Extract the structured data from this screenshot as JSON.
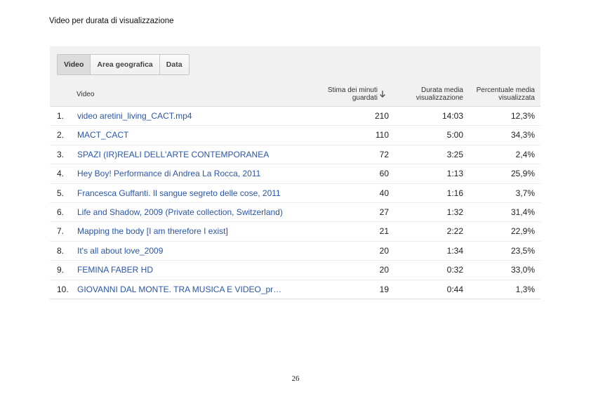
{
  "doc": {
    "title": "Video per durata di visualizzazione",
    "page_number": "26"
  },
  "tabs": [
    {
      "label": "Video",
      "active": true
    },
    {
      "label": "Area geografica",
      "active": false
    },
    {
      "label": "Data",
      "active": false
    }
  ],
  "columns": {
    "video": "Video",
    "minutes_line1": "Stima dei minuti",
    "minutes_line2": "guardati",
    "duration_line1": "Durata media",
    "duration_line2": "visualizzazione",
    "percent_line1": "Percentuale media",
    "percent_line2": "visualizzata",
    "sort_icon": "arrow-down-icon"
  },
  "rows": [
    {
      "num": "1.",
      "title": "video aretini_living_CACT.mp4",
      "minutes": "210",
      "duration": "14:03",
      "percent": "12,3%"
    },
    {
      "num": "2.",
      "title": "MACT_CACT",
      "minutes": "110",
      "duration": "5:00",
      "percent": "34,3%"
    },
    {
      "num": "3.",
      "title": "SPAZI (IR)REALI DELL'ARTE CONTEMPORANEA",
      "minutes": "72",
      "duration": "3:25",
      "percent": "2,4%"
    },
    {
      "num": "4.",
      "title": "Hey Boy! Performance di Andrea La Rocca, 2011",
      "minutes": "60",
      "duration": "1:13",
      "percent": "25,9%"
    },
    {
      "num": "5.",
      "title": "Francesca Guffanti. Il sangue segreto delle cose, 2011",
      "minutes": "40",
      "duration": "1:16",
      "percent": "3,7%"
    },
    {
      "num": "6.",
      "title": "Life and Shadow, 2009 (Private collection, Switzerland)",
      "minutes": "27",
      "duration": "1:32",
      "percent": "31,4%"
    },
    {
      "num": "7.",
      "title": "Mapping the body [I am therefore I exist]",
      "minutes": "21",
      "duration": "2:22",
      "percent": "22,9%"
    },
    {
      "num": "8.",
      "title": "It's all about love_2009",
      "minutes": "20",
      "duration": "1:34",
      "percent": "23,5%"
    },
    {
      "num": "9.",
      "title": "FEMINA FABER HD",
      "minutes": "20",
      "duration": "0:32",
      "percent": "33,0%"
    },
    {
      "num": "10.",
      "title": "GIOVANNI DAL MONTE. TRA MUSICA E VIDEO_pr…",
      "minutes": "19",
      "duration": "0:44",
      "percent": "1,3%"
    }
  ]
}
